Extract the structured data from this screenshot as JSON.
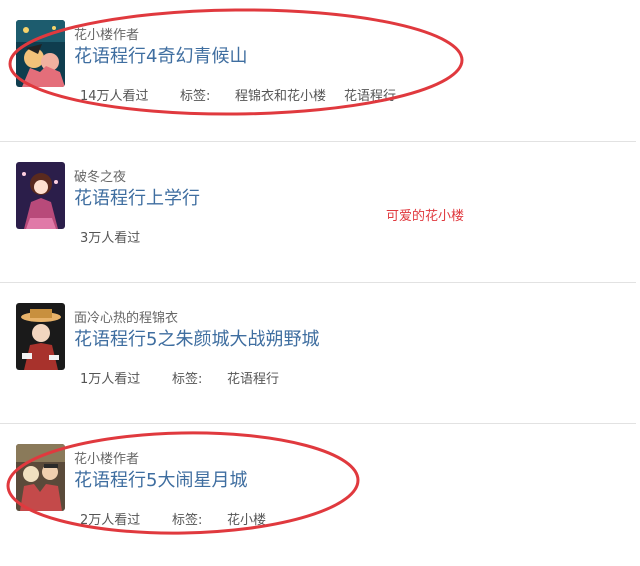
{
  "items": [
    {
      "author": "花小楼作者",
      "title": "花语程行4奇幻青候山",
      "views": "14万人看过",
      "tag_label": "标签:",
      "tags": [
        "程锦衣和花小楼",
        "花语程行"
      ],
      "thumb_colors": [
        "#0f3d4e",
        "#e46e7a",
        "#f3c27a"
      ]
    },
    {
      "author": "破冬之夜",
      "title": "花语程行上学行",
      "views": "3万人看过",
      "tag_label": "",
      "tags": [],
      "thumb_colors": [
        "#2b1e4a",
        "#b84a7a",
        "#ffd0e0"
      ]
    },
    {
      "author": "面冷心热的程锦衣",
      "title": "花语程行5之朱颜城大战朔野城",
      "views": "1万人看过",
      "tag_label": "标签:",
      "tags": [
        "花语程行"
      ],
      "thumb_colors": [
        "#1a1a1a",
        "#a8322c",
        "#e8b36a"
      ]
    },
    {
      "author": "花小楼作者",
      "title": "花语程行5大闹星月城",
      "views": "2万人看过",
      "tag_label": "标签:",
      "tags": [
        "花小楼"
      ],
      "thumb_colors": [
        "#5a4a3a",
        "#c44a4a",
        "#f0e0c0"
      ]
    }
  ],
  "annotation": "可爱的花小楼",
  "highlight_color": "#e0393e"
}
